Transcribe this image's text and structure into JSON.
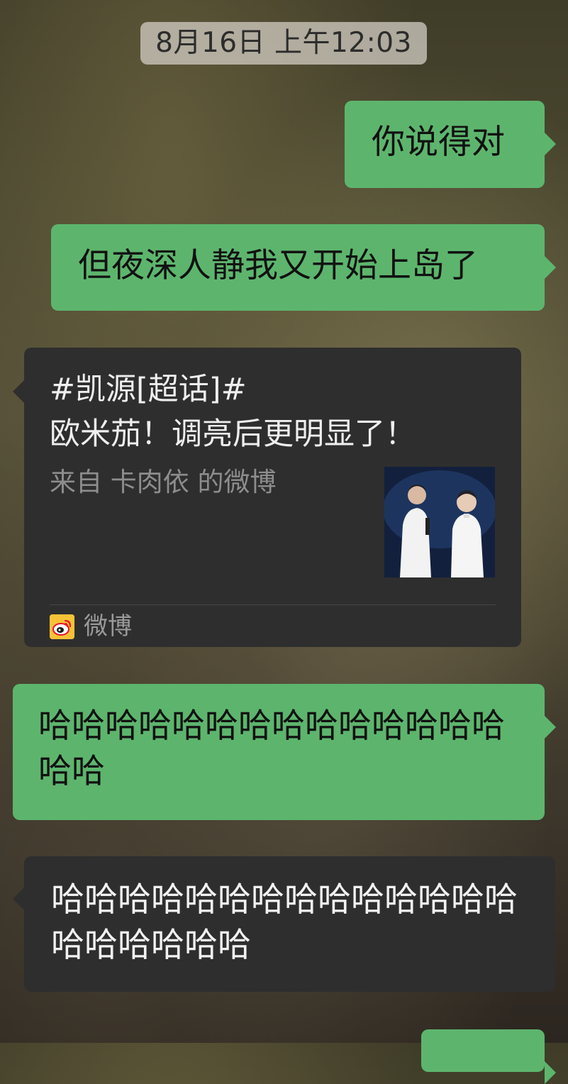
{
  "timestamp": "8月16日 上午12:03",
  "messages": [
    {
      "text": "你说得对"
    },
    {
      "text": "但夜深人静我又开始上岛了"
    },
    {
      "card": {
        "title_line1": "#凯源[超话]#",
        "title_line2": "欧米茄！调亮后更明显了！",
        "source": "来自 卡肉依 的微博",
        "app_name": "微博",
        "app_icon": "weibo-icon"
      }
    },
    {
      "text": "哈哈哈哈哈哈哈哈哈哈哈哈哈哈哈哈"
    },
    {
      "text": "哈哈哈哈哈哈哈哈哈哈哈哈哈哈哈哈哈哈哈哈"
    }
  ],
  "colors": {
    "sent_bubble": "#5db56d",
    "received_bubble": "#2e2e2e",
    "weibo_icon_bg": "#f7c236",
    "weibo_icon_red": "#e6162d"
  }
}
